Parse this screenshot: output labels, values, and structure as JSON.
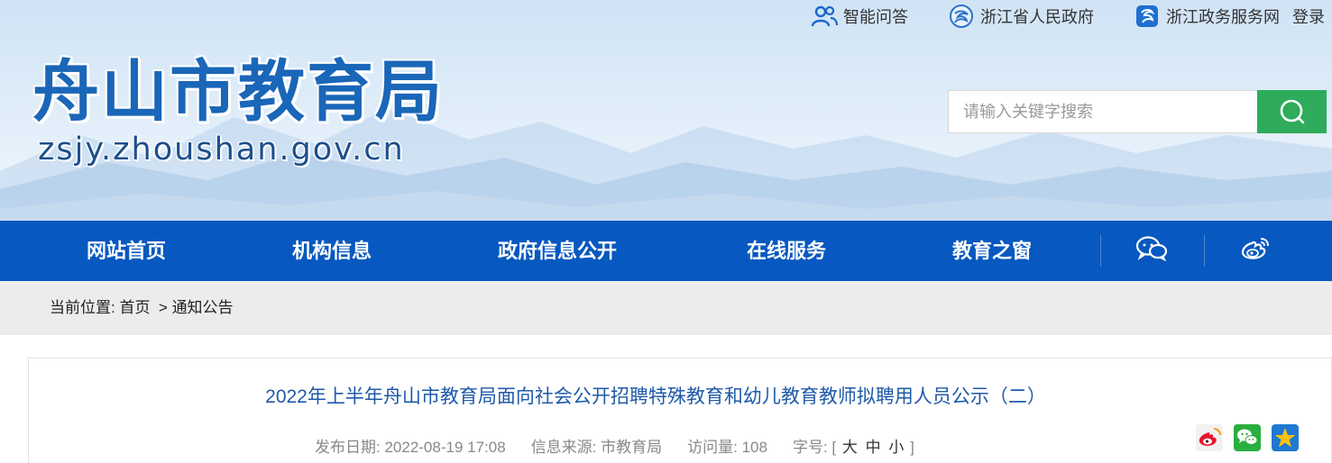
{
  "top_links": [
    {
      "label": "智能问答",
      "icon": "people-icon"
    },
    {
      "label": "浙江省人民政府",
      "icon": "zhejiang-gov-icon"
    },
    {
      "label": "浙江政务服务网",
      "icon": "zj-service-icon"
    }
  ],
  "login_label": "登录",
  "site": {
    "title": "舟山市教育局",
    "domain": "zsjy.zhoushan.gov.cn"
  },
  "search": {
    "placeholder": "请输入关键字搜索",
    "value": ""
  },
  "nav": {
    "items": [
      "网站首页",
      "机构信息",
      "政府信息公开",
      "在线服务",
      "教育之窗"
    ],
    "icons": [
      "wechat-icon",
      "weibo-icon"
    ]
  },
  "breadcrumb": {
    "prefix": "当前位置: ",
    "home": "首页",
    "separator": "  > ",
    "current": "通知公告"
  },
  "article": {
    "title": "2022年上半年舟山市教育局面向社会公开招聘特殊教育和幼儿教育教师拟聘用人员公示（二）",
    "publish_label": "发布日期: ",
    "publish_date": "2022-08-19 17:08",
    "source_label": "信息来源: ",
    "source": "市教育局",
    "visits_label": "访问量: ",
    "visits": "108",
    "font_label": "字号: [ ",
    "font_large": "大",
    "font_medium": "中",
    "font_small": "小",
    "font_close": " ]"
  },
  "share_icons": [
    "weibo-share-icon",
    "wechat-share-icon",
    "qzone-share-icon"
  ],
  "colors": {
    "brand_blue": "#0758c0",
    "title_blue": "#1a66b8",
    "search_green": "#2eac5b",
    "article_title": "#1f5aa8"
  }
}
